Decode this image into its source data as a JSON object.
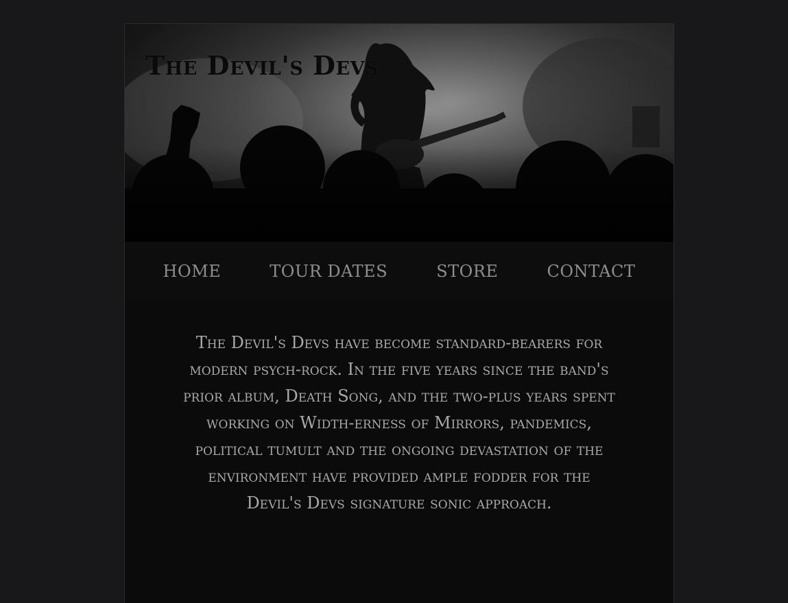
{
  "header": {
    "band_name": "The Devil's Devs"
  },
  "nav": {
    "items": [
      {
        "label": "HOME"
      },
      {
        "label": "TOUR DATES"
      },
      {
        "label": "STORE"
      },
      {
        "label": "CONTACT"
      }
    ]
  },
  "main": {
    "bio": "The Devil's Devs have become standard-bearers for modern psych-rock. In the five years since the band's prior album, Death Song, and the two-plus years spent working on Width-erness of Mirrors, pandemics, political tumult and the ongoing devastation of the environment have provided ample fodder for the Devil's Devs signature sonic approach."
  },
  "colors": {
    "page_background": "#18181a",
    "content_background": "#0b0b0b",
    "nav_text": "#8e8e8e",
    "body_text": "#a9a9a9"
  }
}
